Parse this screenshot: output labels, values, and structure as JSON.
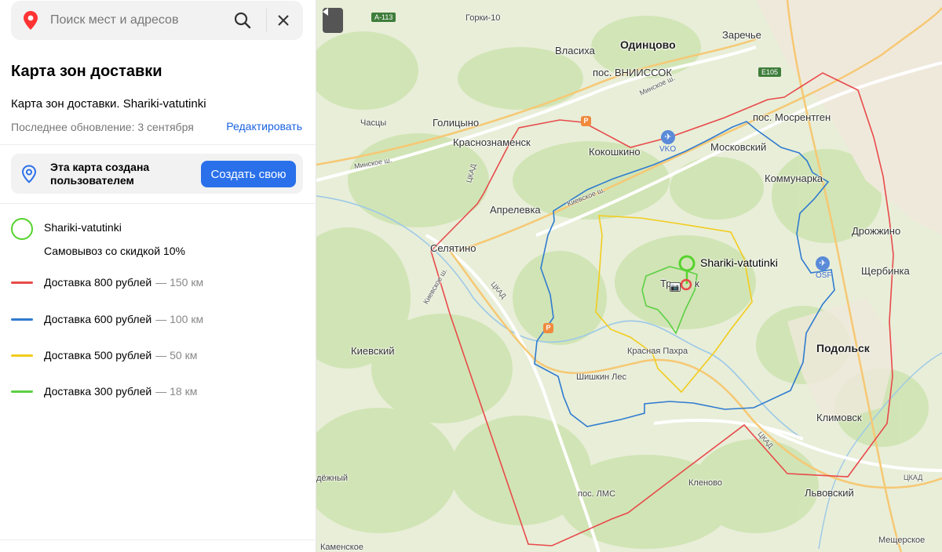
{
  "search": {
    "placeholder": "Поиск мест и адресов"
  },
  "header": {
    "title": "Карта зон доставки",
    "subtitle": "Карта зон доставки. Shariki-vatutinki",
    "updated": "Последнее обновление: 3 сентября",
    "edit_label": "Редактировать"
  },
  "user_box": {
    "text": "Эта карта создана пользователем",
    "button": "Создать свою"
  },
  "legend": {
    "point_name": "Shariki-vatutinki",
    "point_desc": "Самовывоз со скидкой 10%",
    "zones": [
      {
        "label": "Доставка 800 рублей",
        "distance": "— 150 км",
        "color": "#e84a4a"
      },
      {
        "label": "Доставка 600 рублей",
        "distance": "— 100 км",
        "color": "#2f7bd0"
      },
      {
        "label": "Доставка 500 рублей",
        "distance": "— 50 км",
        "color": "#f2cc1c"
      },
      {
        "label": "Доставка 300 рублей",
        "distance": "— 18 км",
        "color": "#5cd044"
      }
    ]
  },
  "map": {
    "places": {
      "odintsovo": "Одинцово",
      "zarechye": "Заречье",
      "vlasikha": "Власиха",
      "vniissok": "пос. ВНИИССОК",
      "gorki10": "Горки-10",
      "golitsyno": "Голицыно",
      "chastsy": "Часцы",
      "krasnoznamensk": "Краснознаменск",
      "kokoshkino": "Кокошкино",
      "mosrentgen": "пос. Мосрентген",
      "moskovsky": "Московский",
      "kommunarka": "Коммунарка",
      "aprelevka": "Апрелевка",
      "selyatino": "Селятино",
      "drozhzhino": "Дрожжино",
      "shcherbinka": "Щербинка",
      "troitsk": "Тр",
      "troitsk_end": "к",
      "krasnaya_pakhra": "Красная Пахра",
      "kievsky": "Киевский",
      "podolsk": "Подольск",
      "shishkin_les": "Шишкин Лес",
      "klimovsk": "Климовск",
      "lms": "пос. ЛМС",
      "klenovo": "Кленово",
      "lvovsky": "Львовский",
      "nadezhny": "дёжный",
      "kamenskoe": "Каменское",
      "meshcherskoe": "Мещерское"
    },
    "roads": {
      "a113": "А-113",
      "e105": "E105",
      "minskoe1": "Минское ш.",
      "minskoe2": "Минское ш.",
      "kievskoe1": "Киевское ш.",
      "kievskoe2": "Киевское ш.",
      "tskad1": "ЦКАД",
      "tskad2": "ЦКАД",
      "tskad3": "ЦКАД",
      "tskad4": "ЦКАД"
    },
    "airports": {
      "vko": "VKO",
      "osf": "OSF"
    },
    "point_label": "Shariki-vatutinki"
  }
}
